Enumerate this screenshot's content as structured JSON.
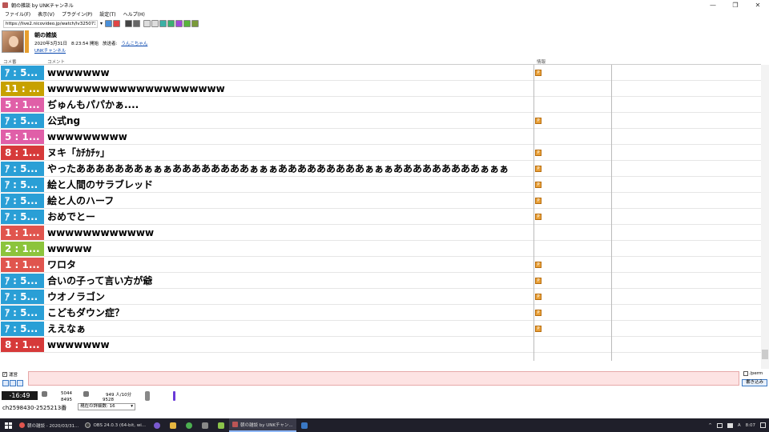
{
  "window": {
    "title": "朝の雑談 by UNKチャンネル",
    "min": "—",
    "max": "❐",
    "close": "✕"
  },
  "menu": [
    "ファイル(F)",
    "表示(V)",
    "プラグイン(P)",
    "設定(T)",
    "ヘルプ(H)"
  ],
  "url": {
    "value": "https://live2.nicovideo.jp/watch/lv325071"
  },
  "program": {
    "title": "朝の雑談",
    "date": "2020年3月31日",
    "time": "8:23:54 開始",
    "broadcaster_label": "放送者:",
    "broadcaster": "うんこちゃん",
    "channel": "UNKチャンネル"
  },
  "columns": {
    "no": "コメ番",
    "comment": "コメント",
    "info": "情報"
  },
  "rows": [
    {
      "no": "ｱ : 5...",
      "text": "wwwwwww",
      "color": "#2a9fd6",
      "p": true
    },
    {
      "no": "11 : ...",
      "text": "wwwwwwwwwwwwwwwwwwww",
      "color": "#c7a100",
      "p": false
    },
    {
      "no": "5 : 1...",
      "text": "ぢゅんもパパかぁ....",
      "color": "#e05fa8",
      "p": false
    },
    {
      "no": "ｱ : 5...",
      "text": "公式ng",
      "color": "#2a9fd6",
      "p": true
    },
    {
      "no": "5 : 1...",
      "text": "wwwwwwwww",
      "color": "#e05fa8",
      "p": false
    },
    {
      "no": "8 : 1...",
      "text": "ヌキ「ｶﾁｶﾁｯ」",
      "color": "#d63a3a",
      "p": true
    },
    {
      "no": "ｱ : 5...",
      "text": "やったあああああああぁぁぁああああああああぁぁぁあああああああああぁぁぁあああああああああぁぁぁ",
      "color": "#2a9fd6",
      "p": true
    },
    {
      "no": "ｱ : 5...",
      "text": "絵と人間のサラブレッド",
      "color": "#2a9fd6",
      "p": true
    },
    {
      "no": "ｱ : 5...",
      "text": "絵と人のハーフ",
      "color": "#2a9fd6",
      "p": true
    },
    {
      "no": "ｱ : 5...",
      "text": "おめでとー",
      "color": "#2a9fd6",
      "p": true
    },
    {
      "no": "1 : 1...",
      "text": "wwwwwwwwwwww",
      "color": "#e0554e",
      "p": false
    },
    {
      "no": "2 : 1...",
      "text": "wwwww",
      "color": "#8cc43c",
      "p": false
    },
    {
      "no": "1 : 1...",
      "text": "ワロタ",
      "color": "#e0554e",
      "p": true
    },
    {
      "no": "ｱ : 5...",
      "text": "合いの子って言い方が爺",
      "color": "#2a9fd6",
      "p": true
    },
    {
      "no": "ｱ : 5...",
      "text": "ウオノラゴン",
      "color": "#2a9fd6",
      "p": true
    },
    {
      "no": "ｱ : 5...",
      "text": "こどもダウン症？",
      "color": "#2a9fd6",
      "p": true
    },
    {
      "no": "ｱ : 5...",
      "text": "ええなぁ",
      "color": "#2a9fd6",
      "p": true
    },
    {
      "no": "8 : 1...",
      "text": "wwwwwww",
      "color": "#d63a3a",
      "p": false
    }
  ],
  "p_mark": "P",
  "input": {
    "unei_label": "運営",
    "check": "✓",
    "perm_label": "/perm",
    "send": "書き込み"
  },
  "status": {
    "timer": "-16:49",
    "viewers": "5044",
    "comments": "8495",
    "rate": "949 人/10分",
    "rate2": "9528",
    "channel_id": "ch2598430-2525213番",
    "level_select": "現在の詳細数: 16",
    "caret": "▾"
  },
  "taskbar": {
    "tasks": [
      {
        "label": "朝の雑談 - 2020/03/31...",
        "color": "#e0554e"
      },
      {
        "label": "OBS 24.0.3 (64-bit, wi...",
        "color": "#444"
      }
    ],
    "active": "朝の雑談 by UNKチャン...",
    "time": "8:07",
    "ime": "A"
  }
}
